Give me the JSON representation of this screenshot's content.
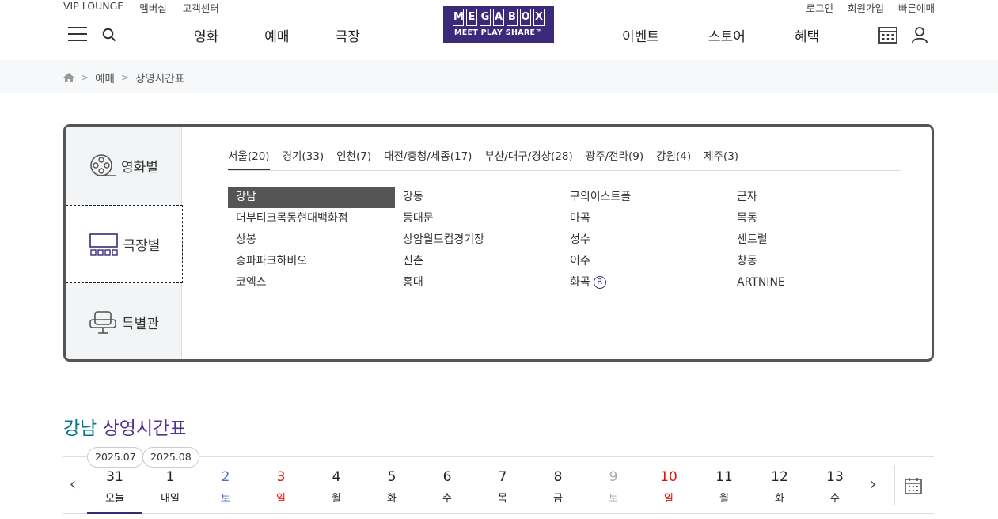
{
  "header": {
    "util_left": [
      "VIP LOUNGE",
      "멤버십",
      "고객센터"
    ],
    "util_right": [
      "로그인",
      "회원가입",
      "빠른예매"
    ],
    "logo": {
      "letters": [
        "M",
        "E",
        "G",
        "A",
        "B",
        "O",
        "X"
      ],
      "sub": "MEET PLAY SHARE™"
    },
    "gnb_left": [
      "영화",
      "예매",
      "극장"
    ],
    "gnb_right": [
      "이벤트",
      "스토어",
      "혜택"
    ]
  },
  "breadcrumb": {
    "items": [
      "예매",
      "상영시간표"
    ]
  },
  "theater_tabs": [
    "영화별",
    "극장별",
    "특별관"
  ],
  "regions": [
    "서울(20)",
    "경기(33)",
    "인천(7)",
    "대전/충청/세종(17)",
    "부산/대구/경상(28)",
    "광주/전라(9)",
    "강원(4)",
    "제주(3)"
  ],
  "theaters": [
    "강남",
    "강동",
    "구의이스트폴",
    "군자",
    "더부티크목동현대백화점",
    "동대문",
    "마곡",
    "목동",
    "상봉",
    "상암월드컵경기장",
    "성수",
    "센트럴",
    "송파파크하비오",
    "신촌",
    "이수",
    "창동",
    "코엑스",
    "홍대",
    "화곡",
    "ARTNINE"
  ],
  "theater_badge": "R",
  "title": {
    "name": "강남",
    "rest": "상영시간표"
  },
  "months": [
    "2025.07",
    "2025.08"
  ],
  "days": [
    {
      "num": "31",
      "wd": "오늘"
    },
    {
      "num": "1",
      "wd": "내일"
    },
    {
      "num": "2",
      "wd": "토"
    },
    {
      "num": "3",
      "wd": "일"
    },
    {
      "num": "4",
      "wd": "월"
    },
    {
      "num": "5",
      "wd": "화"
    },
    {
      "num": "6",
      "wd": "수"
    },
    {
      "num": "7",
      "wd": "목"
    },
    {
      "num": "8",
      "wd": "금"
    },
    {
      "num": "9",
      "wd": "토"
    },
    {
      "num": "10",
      "wd": "일"
    },
    {
      "num": "11",
      "wd": "월"
    },
    {
      "num": "12",
      "wd": "화"
    },
    {
      "num": "13",
      "wd": "수"
    }
  ],
  "colors": {
    "brand": "#3b2a7a",
    "sat": "#4b72c6",
    "sun": "#e81002",
    "disabled": "#aaa",
    "title_name": "#01738b",
    "title_rest": "#503396"
  }
}
